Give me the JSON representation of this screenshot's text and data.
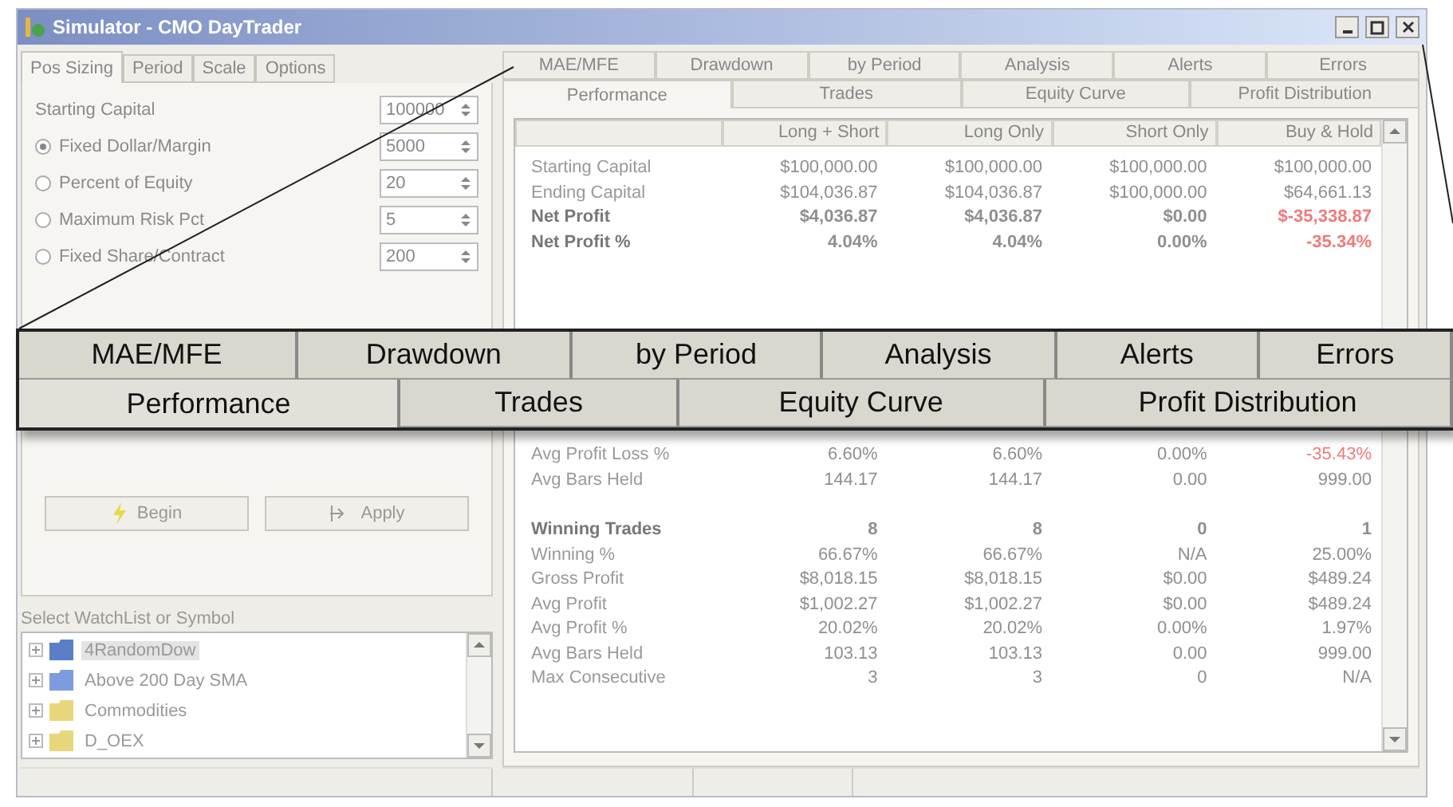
{
  "window": {
    "title": "Simulator - CMO DayTrader"
  },
  "left_tabs": [
    {
      "label": "Pos Sizing",
      "selected": true
    },
    {
      "label": "Period",
      "selected": false
    },
    {
      "label": "Scale",
      "selected": false
    },
    {
      "label": "Options",
      "selected": false
    }
  ],
  "settings": [
    {
      "kind": "plain",
      "label": "Starting Capital",
      "value": "100000"
    },
    {
      "kind": "radio",
      "label": "Fixed Dollar/Margin",
      "value": "5000",
      "checked": true
    },
    {
      "kind": "radio",
      "label": "Percent of Equity",
      "value": "20",
      "checked": false
    },
    {
      "kind": "radio",
      "label": "Maximum Risk Pct",
      "value": "5",
      "checked": false
    },
    {
      "kind": "radio",
      "label": "Fixed Share/Contract",
      "value": "200",
      "checked": false
    }
  ],
  "buttons": [
    {
      "label": "Begin"
    },
    {
      "label": "Apply"
    }
  ],
  "watchlist": {
    "label": "Select WatchList or Symbol",
    "items": [
      {
        "label": "4RandomDow",
        "color": "#5a7fc8",
        "selected": true
      },
      {
        "label": "Above 200 Day SMA",
        "color": "#7d9be0",
        "selected": false
      },
      {
        "label": "Commodities",
        "color": "#e8d77a",
        "selected": false
      },
      {
        "label": "D_OEX",
        "color": "#e8d77a",
        "selected": false
      }
    ]
  },
  "tabs_row1": [
    {
      "label": "MAE/MFE",
      "selected": false
    },
    {
      "label": "Drawdown",
      "selected": false
    },
    {
      "label": "by Period",
      "selected": false
    },
    {
      "label": "Analysis",
      "selected": false
    },
    {
      "label": "Alerts",
      "selected": false
    },
    {
      "label": "Errors",
      "selected": false
    }
  ],
  "tabs_row2": [
    {
      "label": "Performance",
      "selected": true
    },
    {
      "label": "Trades",
      "selected": false
    },
    {
      "label": "Equity Curve",
      "selected": false
    },
    {
      "label": "Profit Distribution",
      "selected": false
    }
  ],
  "table": {
    "columns": [
      "Long + Short",
      "Long Only",
      "Short Only",
      "Buy & Hold"
    ],
    "rows_top": [
      {
        "label": "Starting Capital",
        "bold": false,
        "cells": [
          {
            "value": "$100,000.00",
            "negative": false
          },
          {
            "value": "$100,000.00",
            "negative": false
          },
          {
            "value": "$100,000.00",
            "negative": false
          },
          {
            "value": "$100,000.00",
            "negative": false
          }
        ]
      },
      {
        "label": "Ending Capital",
        "bold": false,
        "cells": [
          {
            "value": "$104,036.87",
            "negative": false
          },
          {
            "value": "$104,036.87",
            "negative": false
          },
          {
            "value": "$100,000.00",
            "negative": false
          },
          {
            "value": "$64,661.13",
            "negative": false
          }
        ]
      },
      {
        "label": "Net Profit",
        "bold": true,
        "cells": [
          {
            "value": "$4,036.87",
            "negative": false
          },
          {
            "value": "$4,036.87",
            "negative": false
          },
          {
            "value": "$0.00",
            "negative": false
          },
          {
            "value": "$-35,338.87",
            "negative": true
          }
        ]
      },
      {
        "label": "Net Profit %",
        "bold": true,
        "cells": [
          {
            "value": "4.04%",
            "negative": false
          },
          {
            "value": "4.04%",
            "negative": false
          },
          {
            "value": "0.00%",
            "negative": false
          },
          {
            "value": "-35.34%",
            "negative": true
          }
        ]
      }
    ],
    "rows_bottom": [
      {
        "label": "Avg Profit Loss %",
        "bold": false,
        "cells": [
          {
            "value": "6.60%",
            "negative": false
          },
          {
            "value": "6.60%",
            "negative": false
          },
          {
            "value": "0.00%",
            "negative": false
          },
          {
            "value": "-35.43%",
            "negative": true
          }
        ]
      },
      {
        "label": "Avg Bars Held",
        "bold": false,
        "cells": [
          {
            "value": "144.17",
            "negative": false
          },
          {
            "value": "144.17",
            "negative": false
          },
          {
            "value": "0.00",
            "negative": false
          },
          {
            "value": "999.00",
            "negative": false
          }
        ]
      }
    ],
    "rows_winning": [
      {
        "label": "Winning Trades",
        "bold": true,
        "cells": [
          {
            "value": "8",
            "negative": false
          },
          {
            "value": "8",
            "negative": false
          },
          {
            "value": "0",
            "negative": false
          },
          {
            "value": "1",
            "negative": false
          }
        ]
      },
      {
        "label": "Winning %",
        "bold": false,
        "cells": [
          {
            "value": "66.67%",
            "negative": false
          },
          {
            "value": "66.67%",
            "negative": false
          },
          {
            "value": "N/A",
            "negative": false
          },
          {
            "value": "25.00%",
            "negative": false
          }
        ]
      },
      {
        "label": "Gross Profit",
        "bold": false,
        "cells": [
          {
            "value": "$8,018.15",
            "negative": false
          },
          {
            "value": "$8,018.15",
            "negative": false
          },
          {
            "value": "$0.00",
            "negative": false
          },
          {
            "value": "$489.24",
            "negative": false
          }
        ]
      },
      {
        "label": "Avg Profit",
        "bold": false,
        "cells": [
          {
            "value": "$1,002.27",
            "negative": false
          },
          {
            "value": "$1,002.27",
            "negative": false
          },
          {
            "value": "$0.00",
            "negative": false
          },
          {
            "value": "$489.24",
            "negative": false
          }
        ]
      },
      {
        "label": "Avg Profit %",
        "bold": false,
        "cells": [
          {
            "value": "20.02%",
            "negative": false
          },
          {
            "value": "20.02%",
            "negative": false
          },
          {
            "value": "0.00%",
            "negative": false
          },
          {
            "value": "1.97%",
            "negative": false
          }
        ]
      },
      {
        "label": "Avg Bars Held",
        "bold": false,
        "cells": [
          {
            "value": "103.13",
            "negative": false
          },
          {
            "value": "103.13",
            "negative": false
          },
          {
            "value": "0.00",
            "negative": false
          },
          {
            "value": "999.00",
            "negative": false
          }
        ]
      },
      {
        "label": "Max Consecutive",
        "bold": false,
        "cells": [
          {
            "value": "3",
            "negative": false
          },
          {
            "value": "3",
            "negative": false
          },
          {
            "value": "0",
            "negative": false
          },
          {
            "value": "N/A",
            "negative": false
          }
        ]
      }
    ]
  },
  "magnifier": {
    "tabs_row1": [
      {
        "label": "MAE/MFE",
        "selected": false
      },
      {
        "label": "Drawdown",
        "selected": false
      },
      {
        "label": "by Period",
        "selected": false
      },
      {
        "label": "Analysis",
        "selected": false
      },
      {
        "label": "Alerts",
        "selected": false
      },
      {
        "label": "Errors",
        "selected": false
      }
    ],
    "tabs_row2": [
      {
        "label": "Performance",
        "selected": true
      },
      {
        "label": "Trades",
        "selected": false
      },
      {
        "label": "Equity Curve",
        "selected": false
      },
      {
        "label": "Profit Distribution",
        "selected": false
      }
    ]
  }
}
